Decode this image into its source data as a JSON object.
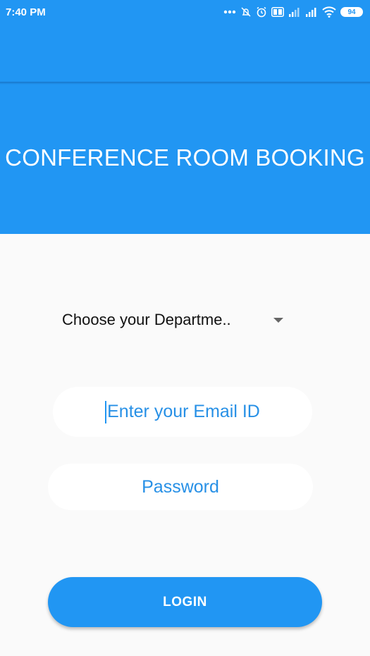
{
  "status_bar": {
    "time": "7:40 PM",
    "icons": [
      "more-dots-icon",
      "alarm-off-icon",
      "alarm-clock-icon",
      "volte-icon",
      "signal-icon",
      "signal-icon",
      "wifi-icon",
      "battery-icon"
    ],
    "battery": "94"
  },
  "header": {
    "title": "CONFERENCE ROOM BOOKING"
  },
  "form": {
    "department_select": {
      "selected": "Choose your Departme.."
    },
    "email": {
      "placeholder": "Enter your Email ID"
    },
    "password": {
      "placeholder": "Password"
    },
    "login_label": "LOGIN"
  },
  "colors": {
    "primary": "#2196f3",
    "background": "#fafafa",
    "field_text": "#2790e6"
  }
}
